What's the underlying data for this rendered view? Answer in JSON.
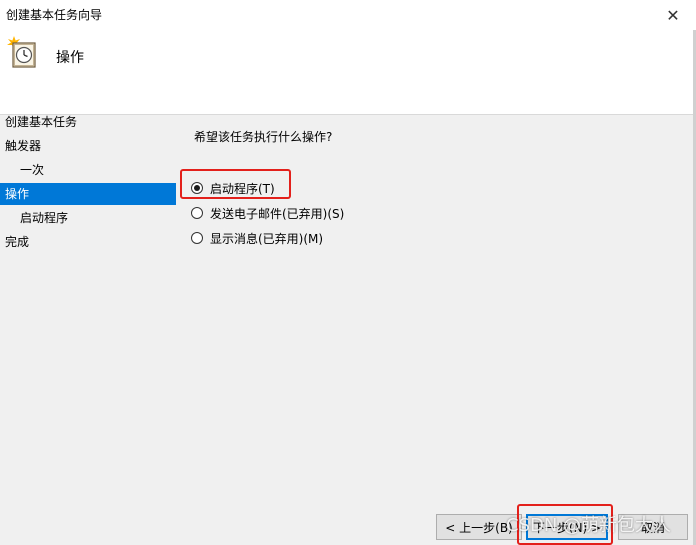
{
  "window": {
    "title": "创建基本任务向导",
    "close_glyph": "✕"
  },
  "header": {
    "title": "操作",
    "icon": "task-scheduler-clock-icon"
  },
  "nav": {
    "items": [
      {
        "label": "创建基本任务",
        "active": false
      },
      {
        "label": "触发器",
        "active": false
      },
      {
        "label": "一次",
        "active": false
      },
      {
        "label": "操作",
        "active": true
      },
      {
        "label": "启动程序",
        "active": false
      },
      {
        "label": "完成",
        "active": false
      }
    ]
  },
  "main": {
    "question": "希望该任务执行什么操作?",
    "options": [
      {
        "label": "启动程序(T)",
        "selected": true
      },
      {
        "label": "发送电子邮件(已弃用)(S)",
        "selected": false
      },
      {
        "label": "显示消息(已弃用)(M)",
        "selected": false
      }
    ]
  },
  "buttons": {
    "back": "< 上一步(B)",
    "next": "下一步(N) >",
    "cancel": "取消"
  },
  "watermark": "CSDN @萌新包大人",
  "colors": {
    "accent": "#0078d7",
    "highlight_box": "#e3201b",
    "background": "#f0f0f0"
  }
}
